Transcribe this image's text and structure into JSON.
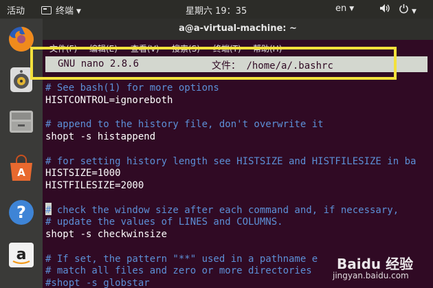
{
  "topbar": {
    "activities": "活动",
    "app_menu": "终端",
    "clock": "星期六 19：35",
    "lang": "en",
    "volume_icon": "volume-icon",
    "power_icon": "power-icon"
  },
  "launcher": {
    "items": [
      "firefox-icon",
      "rhythmbox-icon",
      "files-icon",
      "software-center-icon",
      "help-icon",
      "amazon-icon"
    ]
  },
  "window": {
    "title": "a@a-virtual-machine: ~",
    "menu": [
      "文件(F)",
      "编辑(E)",
      "查看(V)",
      "搜索(S)",
      "终端(T)",
      "帮助(H)"
    ]
  },
  "nano": {
    "version": "GNU nano 2.8.6",
    "file_label": "文件：",
    "file_path": "/home/a/.bashrc",
    "lines": [
      {
        "text": "# See bash(1) for more options",
        "kind": "comment"
      },
      {
        "text": "HISTCONTROL=ignoreboth",
        "kind": "code"
      },
      {
        "text": "",
        "kind": "code"
      },
      {
        "text": "# append to the history file, don't overwrite it",
        "kind": "comment"
      },
      {
        "text": "shopt -s histappend",
        "kind": "code"
      },
      {
        "text": "",
        "kind": "code"
      },
      {
        "text": "# for setting history length see HISTSIZE and HISTFILESIZE in ba",
        "kind": "comment"
      },
      {
        "text": "HISTSIZE=1000",
        "kind": "code"
      },
      {
        "text": "HISTFILESIZE=2000",
        "kind": "code"
      },
      {
        "text": "",
        "kind": "code"
      },
      {
        "text": "# check the window size after each command and, if necessary,",
        "kind": "comment"
      },
      {
        "text": "# update the values of LINES and COLUMNS.",
        "kind": "comment"
      },
      {
        "text": "shopt -s checkwinsize",
        "kind": "code"
      },
      {
        "text": "",
        "kind": "code"
      },
      {
        "text": "# If set, the pattern \"**\" used in a pathname e",
        "kind": "comment"
      },
      {
        "text": "# match all files and zero or more directories",
        "kind": "comment"
      },
      {
        "text": "#shopt -s globstar",
        "kind": "comment"
      }
    ]
  },
  "watermark": {
    "logo": "Baidu 经验",
    "url": "jingyan.baidu.com"
  },
  "colors": {
    "terminal_bg": "#300a24",
    "comment": "#5c8fd6",
    "highlight_box": "#f3e13c"
  }
}
